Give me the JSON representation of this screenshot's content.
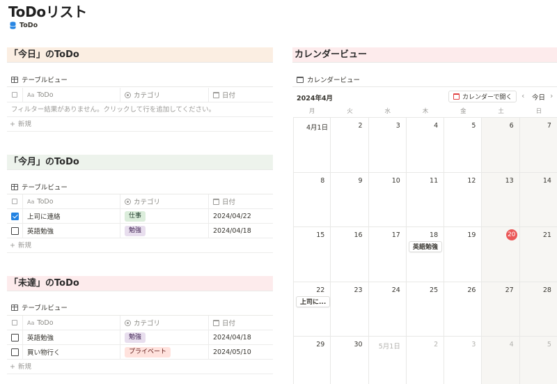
{
  "page": {
    "title": "ToDoリスト",
    "db_link": "ToDo"
  },
  "today_section": {
    "heading": "「今日」のToDo",
    "view": "テーブルビュー",
    "columns": {
      "todo": "ToDo",
      "category": "カテゴリ",
      "date": "日付"
    },
    "empty_text": "フィルター結果がありません。クリックして行を追加してください。",
    "new_label": "新規"
  },
  "month_section": {
    "heading": "「今月」のToDo",
    "view": "テーブルビュー",
    "columns": {
      "todo": "ToDo",
      "category": "カテゴリ",
      "date": "日付"
    },
    "rows": [
      {
        "done": true,
        "todo": "上司に連絡",
        "category": "仕事",
        "date": "2024/04/22"
      },
      {
        "done": false,
        "todo": "英語勉強",
        "category": "勉強",
        "date": "2024/04/18"
      }
    ],
    "new_label": "新規"
  },
  "undone_section": {
    "heading": "「未達」のToDo",
    "view": "テーブルビュー",
    "columns": {
      "todo": "ToDo",
      "category": "カテゴリ",
      "date": "日付"
    },
    "rows": [
      {
        "done": false,
        "todo": "英語勉強",
        "category": "勉強",
        "date": "2024/04/18"
      },
      {
        "done": false,
        "todo": "買い物行く",
        "category": "プライベート",
        "date": "2024/05/10"
      }
    ],
    "new_label": "新規"
  },
  "calendar": {
    "heading": "カレンダービュー",
    "view": "カレンダービュー",
    "month": "2024年4月",
    "open_button": "カレンダーで開く",
    "today_button": "今日",
    "weekdays": [
      "月",
      "火",
      "水",
      "木",
      "金",
      "土",
      "日"
    ],
    "weeks": [
      [
        "4月1日",
        "2",
        "3",
        "4",
        "5",
        "6",
        "7"
      ],
      [
        "8",
        "9",
        "10",
        "11",
        "12",
        "13",
        "14"
      ],
      [
        "15",
        "16",
        "17",
        "18",
        "19",
        "20",
        "21"
      ],
      [
        "22",
        "23",
        "24",
        "25",
        "26",
        "27",
        "28"
      ],
      [
        "29",
        "30",
        "5月1日",
        "2",
        "3",
        "4",
        "5"
      ]
    ],
    "today_day": "20",
    "events": {
      "english": "英語勉強",
      "boss": "上司に..."
    }
  },
  "colors": {
    "accent": "#2383e2",
    "today": "#eb5757",
    "tag_work": "#dbeddb",
    "tag_study": "#e8deee",
    "tag_private": "#ffe2dd"
  }
}
